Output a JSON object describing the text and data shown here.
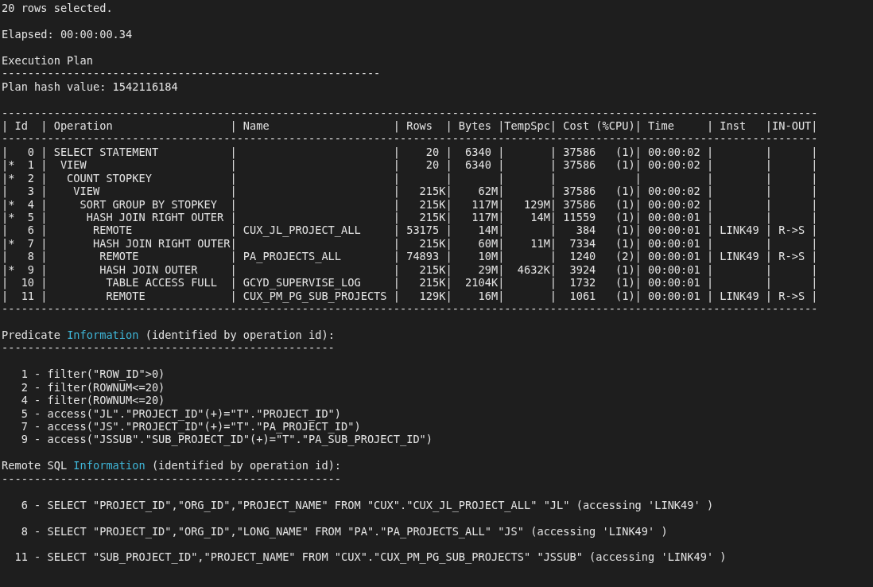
{
  "terminal": {
    "lines": [
      {
        "kind": "text",
        "text": "20 rows selected."
      },
      {
        "kind": "blank"
      },
      {
        "kind": "text",
        "text": "Elapsed: 00:00:00.34"
      },
      {
        "kind": "blank"
      },
      {
        "kind": "text",
        "text": "Execution Plan"
      },
      {
        "kind": "rule",
        "text": "----------------------------------------------------------"
      },
      {
        "kind": "text",
        "text": "Plan hash value: 1542116184"
      },
      {
        "kind": "blank"
      },
      {
        "kind": "rule",
        "text": "-----------------------------------------------------------------------------------------------------------------------------"
      },
      {
        "kind": "header",
        "text": "| Id  | Operation                  | Name                   | Rows  | Bytes |TempSpc| Cost (%CPU)| Time     | Inst   |IN-OUT|"
      },
      {
        "kind": "rule",
        "text": "-----------------------------------------------------------------------------------------------------------------------------"
      },
      {
        "kind": "row",
        "text": "|   0 | SELECT STATEMENT           |                        |    20 |  6340 |       | 37586   (1)| 00:00:02 |        |      |"
      },
      {
        "kind": "row",
        "text": "|*  1 |  VIEW                      |                        |    20 |  6340 |       | 37586   (1)| 00:00:02 |        |      |"
      },
      {
        "kind": "row",
        "text": "|*  2 |   COUNT STOPKEY            |                        |       |       |       |            |          |        |      |"
      },
      {
        "kind": "row",
        "text": "|   3 |    VIEW                    |                        |   215K|    62M|       | 37586   (1)| 00:00:02 |        |      |"
      },
      {
        "kind": "row",
        "text": "|*  4 |     SORT GROUP BY STOPKEY  |                        |   215K|   117M|   129M| 37586   (1)| 00:00:02 |        |      |"
      },
      {
        "kind": "row",
        "text": "|*  5 |      HASH JOIN RIGHT OUTER |                        |   215K|   117M|    14M| 11559   (1)| 00:00:01 |        |      |"
      },
      {
        "kind": "row",
        "text": "|   6 |       REMOTE               | CUX_JL_PROJECT_ALL     | 53175 |    14M|       |   384   (1)| 00:00:01 | LINK49 | R->S |"
      },
      {
        "kind": "row",
        "text": "|*  7 |       HASH JOIN RIGHT OUTER|                        |   215K|    60M|    11M|  7334   (1)| 00:00:01 |        |      |"
      },
      {
        "kind": "row",
        "text": "|   8 |        REMOTE              | PA_PROJECTS_ALL        | 74893 |    10M|       |  1240   (2)| 00:00:01 | LINK49 | R->S |"
      },
      {
        "kind": "row",
        "text": "|*  9 |        HASH JOIN OUTER     |                        |   215K|    29M|  4632K|  3924   (1)| 00:00:01 |        |      |"
      },
      {
        "kind": "row",
        "text": "|  10 |         TABLE ACCESS FULL  | GCYD_SUPERVISE_LOG     |   215K|  2104K|       |  1732   (1)| 00:00:01 |        |      |"
      },
      {
        "kind": "row",
        "text": "|  11 |         REMOTE             | CUX_PM_PG_SUB_PROJECTS |   129K|    16M|       |  1061   (1)| 00:00:01 | LINK49 | R->S |"
      },
      {
        "kind": "rule",
        "text": "-----------------------------------------------------------------------------------------------------------------------------"
      },
      {
        "kind": "blank"
      },
      {
        "kind": "heading",
        "parts": [
          {
            "text": "Predicate ",
            "highlight": false
          },
          {
            "text": "Information",
            "highlight": true
          },
          {
            "text": " (identified by operation id):",
            "highlight": false
          }
        ]
      },
      {
        "kind": "rule",
        "text": "---------------------------------------------------"
      },
      {
        "kind": "blank"
      },
      {
        "kind": "text",
        "text": "   1 - filter(\"ROW_ID\">0)"
      },
      {
        "kind": "text",
        "text": "   2 - filter(ROWNUM<=20)"
      },
      {
        "kind": "text",
        "text": "   4 - filter(ROWNUM<=20)"
      },
      {
        "kind": "text",
        "text": "   5 - access(\"JL\".\"PROJECT_ID\"(+)=\"T\".\"PROJECT_ID\")"
      },
      {
        "kind": "text",
        "text": "   7 - access(\"JS\".\"PROJECT_ID\"(+)=\"T\".\"PA_PROJECT_ID\")"
      },
      {
        "kind": "text",
        "text": "   9 - access(\"JSSUB\".\"SUB_PROJECT_ID\"(+)=\"T\".\"PA_SUB_PROJECT_ID\")"
      },
      {
        "kind": "blank"
      },
      {
        "kind": "heading",
        "parts": [
          {
            "text": "Remote SQL ",
            "highlight": false
          },
          {
            "text": "Information",
            "highlight": true
          },
          {
            "text": " (identified by operation id):",
            "highlight": false
          }
        ]
      },
      {
        "kind": "rule",
        "text": "----------------------------------------------------"
      },
      {
        "kind": "blank"
      },
      {
        "kind": "text",
        "text": "   6 - SELECT \"PROJECT_ID\",\"ORG_ID\",\"PROJECT_NAME\" FROM \"CUX\".\"CUX_JL_PROJECT_ALL\" \"JL\" (accessing 'LINK49' )"
      },
      {
        "kind": "blank"
      },
      {
        "kind": "text",
        "text": "   8 - SELECT \"PROJECT_ID\",\"ORG_ID\",\"LONG_NAME\" FROM \"PA\".\"PA_PROJECTS_ALL\" \"JS\" (accessing 'LINK49' )"
      },
      {
        "kind": "blank"
      },
      {
        "kind": "text",
        "text": "  11 - SELECT \"SUB_PROJECT_ID\",\"PROJECT_NAME\" FROM \"CUX\".\"CUX_PM_PG_SUB_PROJECTS\" \"JSSUB\" (accessing 'LINK49' )"
      }
    ]
  }
}
